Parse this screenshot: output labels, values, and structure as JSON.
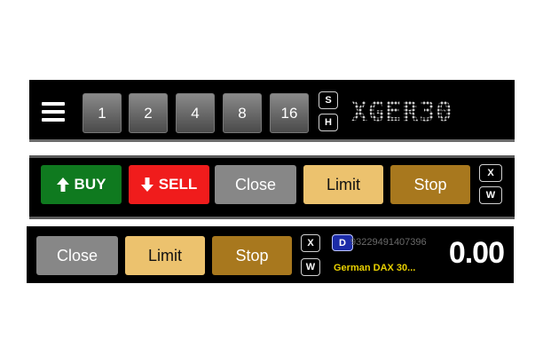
{
  "bar1": {
    "menu_icon": "hamburger-menu-icon",
    "quantity_buttons": [
      "1",
      "2",
      "4",
      "8",
      "16"
    ],
    "toggle_s": "S",
    "toggle_h": "H",
    "symbol": "XGER30"
  },
  "bar2": {
    "buy_label": "BUY",
    "sell_label": "SELL",
    "close_label": "Close",
    "limit_label": "Limit",
    "stop_label": "Stop",
    "x_label": "X",
    "w_label": "W",
    "buy_icon": "arrow-up-icon",
    "sell_icon": "arrow-down-icon"
  },
  "bar3": {
    "close_label": "Close",
    "limit_label": "Limit",
    "stop_label": "Stop",
    "x_label": "X",
    "w_label": "W",
    "d_label": "D",
    "position_id": "93229491407396",
    "instrument_name": "German DAX 30...",
    "value": "0.00"
  },
  "colors": {
    "buy": "#0f7a1f",
    "sell": "#f01c1c",
    "close": "#878787",
    "limit": "#ecc26e",
    "stop": "#a8781e",
    "instrument_name": "#e8d000",
    "d_badge": "#1c2ca8"
  }
}
